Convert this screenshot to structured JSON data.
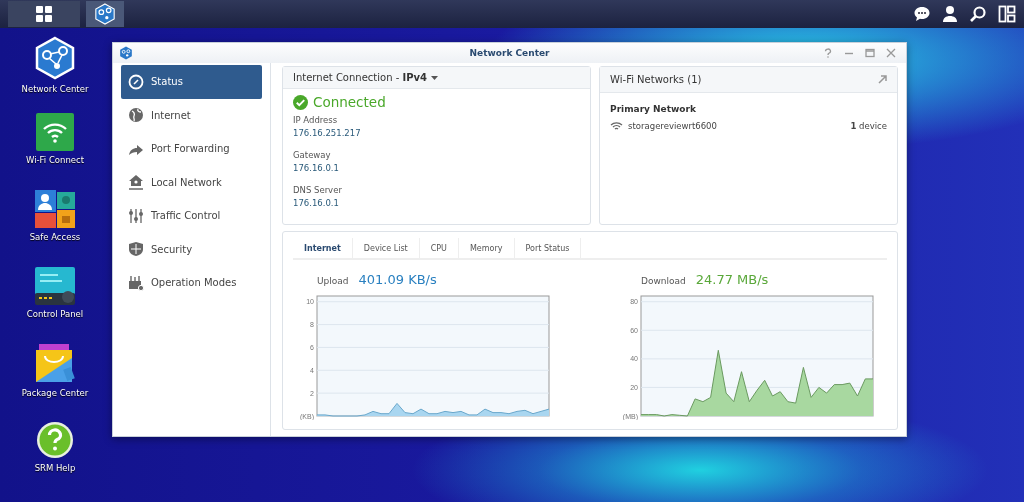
{
  "desktop_icons": [
    {
      "label": "Network Center",
      "kind": "network"
    },
    {
      "label": "Wi-Fi Connect",
      "kind": "wifi"
    },
    {
      "label": "Safe Access",
      "kind": "safe"
    },
    {
      "label": "Control Panel",
      "kind": "panel"
    },
    {
      "label": "Package Center",
      "kind": "package"
    },
    {
      "label": "SRM Help",
      "kind": "help"
    }
  ],
  "window": {
    "title": "Network Center"
  },
  "sidebar": {
    "items": [
      {
        "label": "Status",
        "kind": "status",
        "selected": true
      },
      {
        "label": "Internet",
        "kind": "globe",
        "selected": false
      },
      {
        "label": "Port Forwarding",
        "kind": "forward",
        "selected": false
      },
      {
        "label": "Local Network",
        "kind": "home",
        "selected": false
      },
      {
        "label": "Traffic Control",
        "kind": "sliders",
        "selected": false
      },
      {
        "label": "Security",
        "kind": "shield",
        "selected": false
      },
      {
        "label": "Operation Modes",
        "kind": "router",
        "selected": false
      }
    ]
  },
  "internet_connection": {
    "title": "Internet Connection - ",
    "protocol": "IPv4",
    "status": "Connected",
    "fields": [
      {
        "label": "IP Address",
        "value": "176.16.251.217"
      },
      {
        "label": "Gateway",
        "value": "176.16.0.1"
      },
      {
        "label": "DNS Server",
        "value": "176.16.0.1"
      }
    ]
  },
  "wifi_networks": {
    "title": "Wi-Fi Networks (1)",
    "section": "Primary Network",
    "networks": [
      {
        "name": "storagereviewrt6600",
        "count": "1",
        "unit": "device"
      }
    ]
  },
  "tabs": [
    {
      "label": "Internet",
      "selected": true
    },
    {
      "label": "Device List",
      "selected": false
    },
    {
      "label": "CPU",
      "selected": false
    },
    {
      "label": "Memory",
      "selected": false
    },
    {
      "label": "Port Status",
      "selected": false
    }
  ],
  "upload": {
    "label": "Upload",
    "reading": "401.09 KB/s",
    "chart_data": {
      "type": "area",
      "ylim": [
        0,
        10.5
      ],
      "yticks": [
        {
          "value": 0,
          "label": "(KB)"
        },
        2,
        4,
        6,
        8,
        10
      ],
      "grid": true,
      "series": [
        {
          "color": "#a9d6f0",
          "values": [
            0.1,
            0.1,
            0,
            0,
            0,
            0,
            0.1,
            0.4,
            0.2,
            0.2,
            1.1,
            0.3,
            0.2,
            0.6,
            0.2,
            0.2,
            0.4,
            0.3,
            0.4,
            0.1,
            0.1,
            0.6,
            0.3,
            0.3,
            0.2,
            0.4,
            0.5,
            0.2,
            0.4,
            0.6
          ]
        }
      ]
    }
  },
  "download": {
    "label": "Download",
    "reading": "24.77 MB/s",
    "chart_data": {
      "type": "area",
      "ylim": [
        0,
        84
      ],
      "yticks": [
        {
          "value": 0,
          "label": "(MB)"
        },
        20,
        40,
        60,
        80
      ],
      "grid": true,
      "series": [
        {
          "color": "#a8d8a0",
          "values": [
            1,
            1,
            1,
            0,
            1,
            0.5,
            0,
            12,
            10,
            13,
            46,
            16,
            10,
            31,
            10,
            18,
            25,
            14,
            17,
            10,
            9,
            34,
            13,
            20,
            16,
            22,
            22,
            23,
            14,
            26,
            26
          ]
        }
      ]
    }
  }
}
